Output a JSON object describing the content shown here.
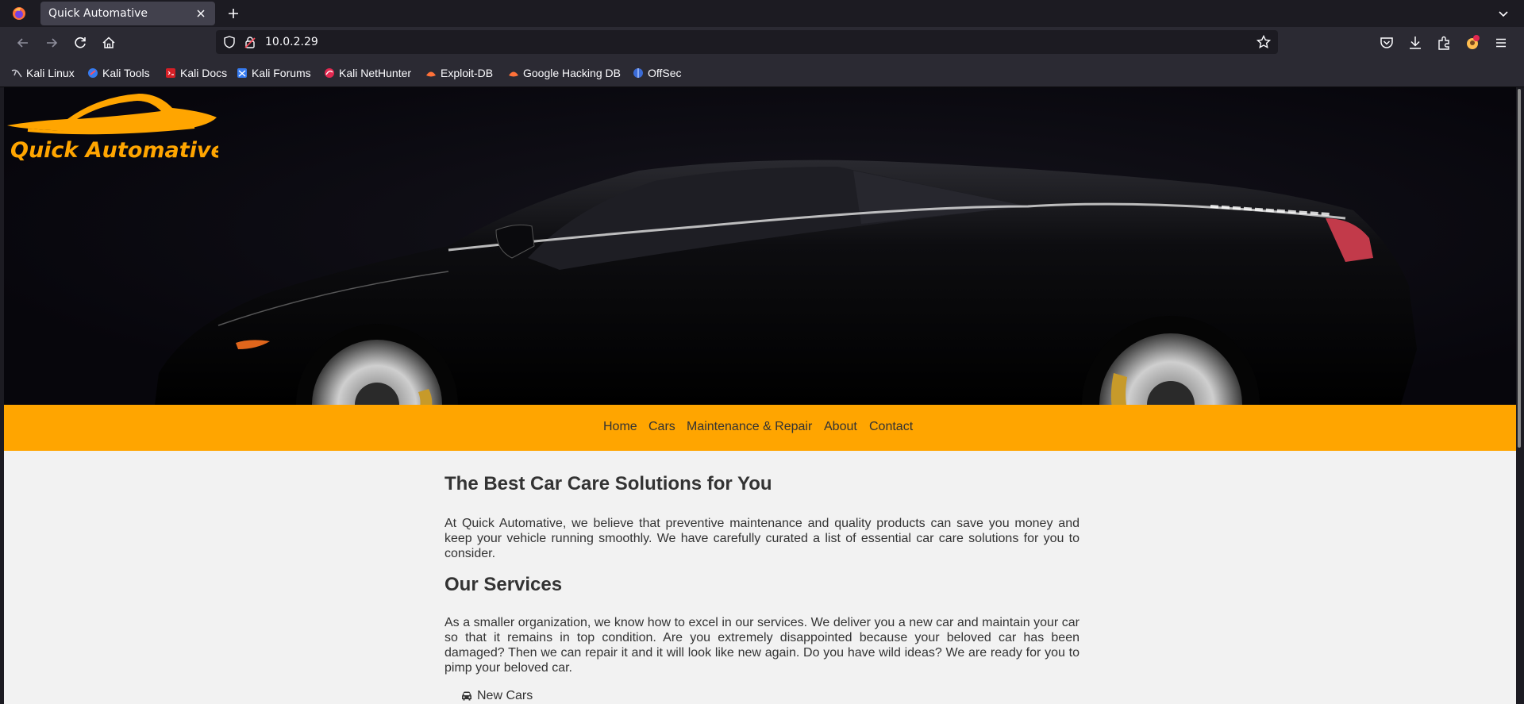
{
  "browser": {
    "tab_title": "Quick Automative",
    "url": "10.0.2.29",
    "bookmarks": [
      {
        "label": "Kali Linux",
        "icon": "kali-linux-icon"
      },
      {
        "label": "Kali Tools",
        "icon": "kali-tools-icon"
      },
      {
        "label": "Kali Docs",
        "icon": "kali-docs-icon"
      },
      {
        "label": "Kali Forums",
        "icon": "kali-forums-icon"
      },
      {
        "label": "Kali NetHunter",
        "icon": "kali-nethunter-icon"
      },
      {
        "label": "Exploit-DB",
        "icon": "exploit-db-icon"
      },
      {
        "label": "Google Hacking DB",
        "icon": "google-hacking-db-icon"
      },
      {
        "label": "OffSec",
        "icon": "offsec-icon"
      }
    ]
  },
  "site": {
    "logo_text": "Quick Automative",
    "nav": [
      "Home",
      "Cars",
      "Maintenance & Repair",
      "About",
      "Contact"
    ],
    "heading": "The Best Car Care Solutions for You",
    "intro": "At Quick Automative, we believe that preventive maintenance and quality products can save you money and keep your vehicle running smoothly. We have carefully curated a list of essential car care solutions for you to consider.",
    "services_heading": "Our Services",
    "services_text": "As a smaller organization, we know how to excel in our services. We deliver you a new car and maintain your car so that it remains in top condition. Are you extremely disappointed because your beloved car has been damaged? Then we can repair it and it will look like new again. Do you have wild ideas? We are ready for you to pimp your beloved car.",
    "services": [
      "New Cars"
    ]
  },
  "colors": {
    "accent": "#ffa500",
    "text": "#333333",
    "hero_bg": "#090811",
    "page_bg": "#f2f2f2"
  }
}
